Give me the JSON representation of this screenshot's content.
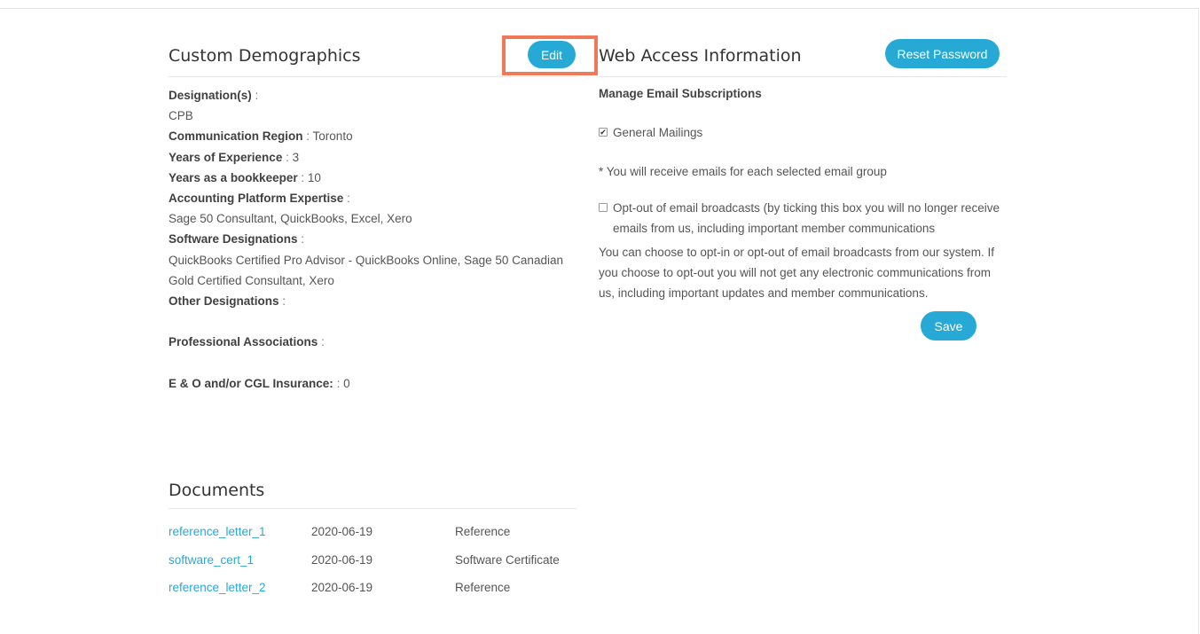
{
  "custom_demographics": {
    "title": "Custom Demographics",
    "edit_label": "Edit",
    "fields": {
      "designations_label": "Designation(s)",
      "designations_value": "CPB",
      "communication_region_label": "Communication Region",
      "communication_region_value": "Toronto",
      "years_experience_label": "Years of Experience",
      "years_experience_value": "3",
      "years_bookkeeper_label": "Years as a bookkeeper",
      "years_bookkeeper_value": "10",
      "accounting_platform_label": "Accounting Platform Expertise",
      "accounting_platform_value": "Sage 50 Consultant, QuickBooks, Excel, Xero",
      "software_designations_label": "Software Designations",
      "software_designations_value": "QuickBooks Certified Pro Advisor - QuickBooks Online, Sage 50 Canadian Gold Certified Consultant, Xero",
      "other_designations_label": "Other Designations",
      "professional_associations_label": "Professional Associations",
      "insurance_label": "E & O and/or CGL Insurance:",
      "insurance_value": "0"
    },
    "separator": ":"
  },
  "web_access": {
    "title": "Web Access Information",
    "reset_password_label": "Reset Password",
    "manage_subscriptions": "Manage Email Subscriptions",
    "general_mailings_label": "General Mailings",
    "general_mailings_checked": true,
    "selected_note": "* You will receive emails for each selected email group",
    "optout_label": "Opt-out of email broadcasts (by ticking this box you will no longer receive emails from us, including important member communications",
    "optout_checked": false,
    "optout_description": "You can choose to opt-in or opt-out of email broadcasts from our system. If you choose to opt-out you will not get any electronic communications from us, including important updates and member communications.",
    "save_label": "Save"
  },
  "documents": {
    "title": "Documents",
    "rows": [
      {
        "name": "reference_letter_1",
        "date": "2020-06-19",
        "type": "Reference"
      },
      {
        "name": "software_cert_1",
        "date": "2020-06-19",
        "type": "Software Certificate"
      },
      {
        "name": "reference_letter_2",
        "date": "2020-06-19",
        "type": "Reference"
      }
    ]
  },
  "colors": {
    "accent": "#27a9d6",
    "highlight": "#f07a57"
  },
  "icons": {
    "checked": "checkbox-checked-icon",
    "unchecked": "checkbox-unchecked-icon"
  }
}
